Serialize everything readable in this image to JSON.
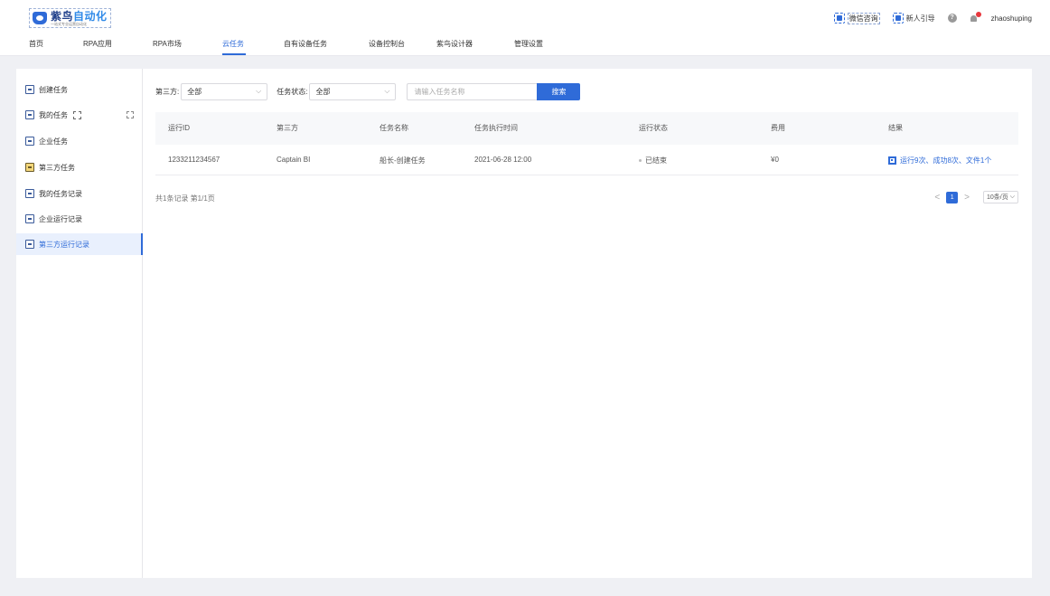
{
  "brand": {
    "name_a": "紫鸟",
    "name_b": "自动化",
    "tagline": "一站式专业运营自动化"
  },
  "nav": {
    "items": [
      {
        "label": "首页"
      },
      {
        "label": "RPA应用"
      },
      {
        "label": "RPA市场"
      },
      {
        "label": "云任务"
      },
      {
        "label": "自有设备任务"
      },
      {
        "label": "设备控制台"
      },
      {
        "label": "紫鸟设计器"
      },
      {
        "label": "管理设置"
      }
    ],
    "active_index": 3
  },
  "header_right": {
    "wechat": "微信咨询",
    "guide": "新人引导",
    "help_icon": "?",
    "username": "zhaoshuping"
  },
  "sidebar": {
    "items": [
      {
        "label": "创建任务",
        "icon": "create-task-icon"
      },
      {
        "label": "我的任务",
        "icon": "my-task-icon"
      },
      {
        "label": "企业任务",
        "icon": "enterprise-task-icon"
      },
      {
        "label": "第三方任务",
        "icon": "third-party-task-icon"
      },
      {
        "label": "我的任务记录",
        "icon": "my-record-icon"
      },
      {
        "label": "企业运行记录",
        "icon": "enterprise-record-icon"
      },
      {
        "label": "第三方运行记录",
        "icon": "third-party-record-icon"
      }
    ],
    "active_index": 6
  },
  "filters": {
    "third_party_label": "第三方:",
    "third_party_value": "全部",
    "status_label": "任务状态:",
    "status_value": "全部",
    "search_placeholder": "请输入任务名称",
    "search_button": "搜索"
  },
  "table": {
    "columns": [
      "运行ID",
      "第三方",
      "任务名称",
      "任务执行时间",
      "运行状态",
      "费用",
      "结果"
    ],
    "rows": [
      {
        "run_id": "1233211234567",
        "third_party": "Captain BI",
        "task_name": "船长-创建任务",
        "exec_time": "2021-06-28  12:00",
        "status": "已结束",
        "cost": "¥0",
        "result": "运行9次、成功8次、文件1个"
      }
    ]
  },
  "pagination": {
    "summary": "共1条记录 第1/1页",
    "current_page": "1",
    "prev": "<",
    "next": ">",
    "page_size": "10条/页"
  },
  "colors": {
    "accent": "#2f6bd8",
    "background": "#eff0f4",
    "badge": "#e8373d"
  }
}
